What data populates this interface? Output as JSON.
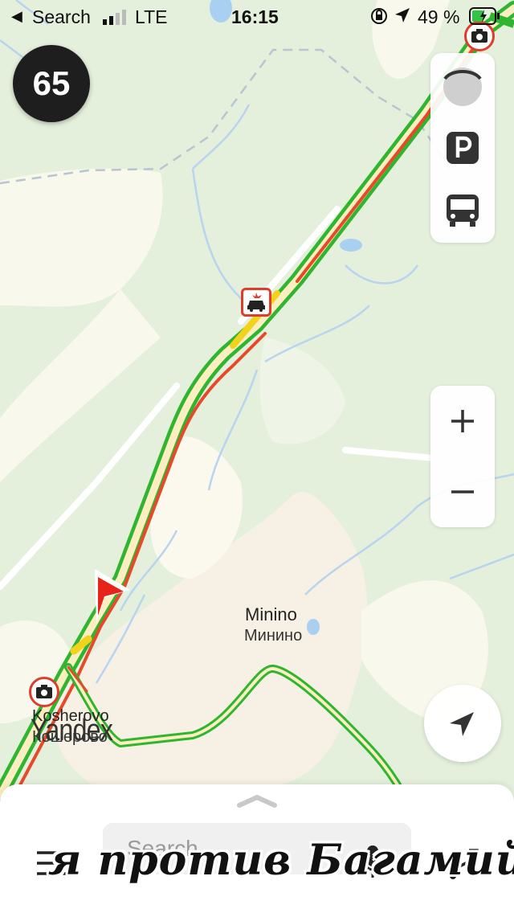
{
  "status_bar": {
    "back_label": "Search",
    "network": "LTE",
    "time": "16:15",
    "battery": "49 %"
  },
  "speed_limit": "65",
  "map": {
    "places": [
      {
        "latin": "Minino",
        "cyrillic": "Минино"
      },
      {
        "latin": "Kosherovo",
        "cyrillic": "Кошерово"
      }
    ],
    "brand": "Yandex"
  },
  "bottom_bar": {
    "search_placeholder": "Search",
    "overlay_caption": "я против Багамий"
  },
  "colors": {
    "traffic_green": "#2fb52f",
    "traffic_yellow": "#f2d21b",
    "traffic_red": "#e64a2a",
    "nav_arrow": "#e6241a",
    "forest": "#e4f0dc",
    "built_area": "#fbf8ee"
  }
}
